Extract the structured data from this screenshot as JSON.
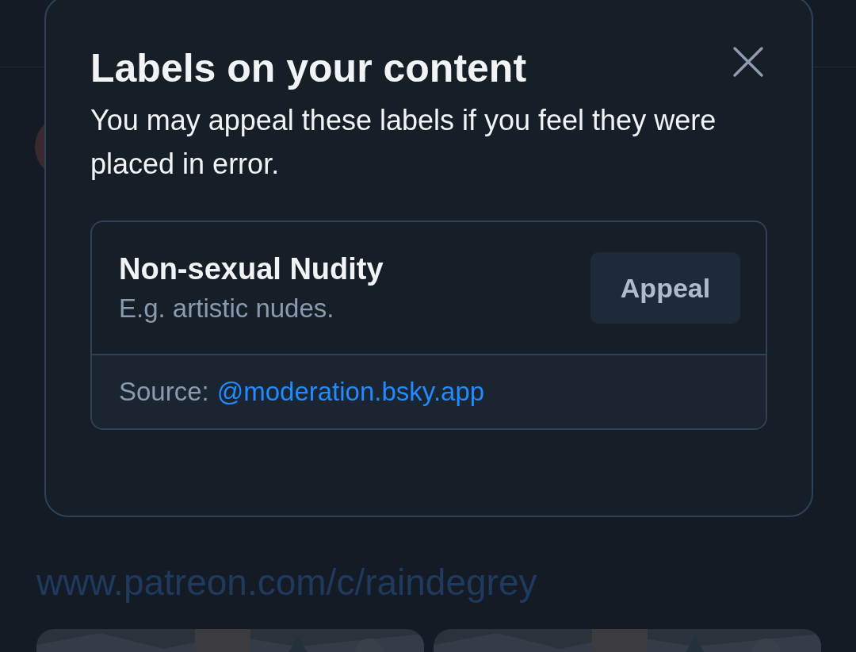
{
  "background": {
    "link": "www.patreon.com/c/raindegrey"
  },
  "dialog": {
    "title": "Labels on your content",
    "description": "You may appeal these labels if you feel they were placed in error.",
    "labels": [
      {
        "name": "Non-sexual Nudity",
        "description": "E.g. artistic nudes.",
        "action": "Appeal",
        "source_label": "Source:",
        "source": "@moderation.bsky.app"
      }
    ]
  }
}
